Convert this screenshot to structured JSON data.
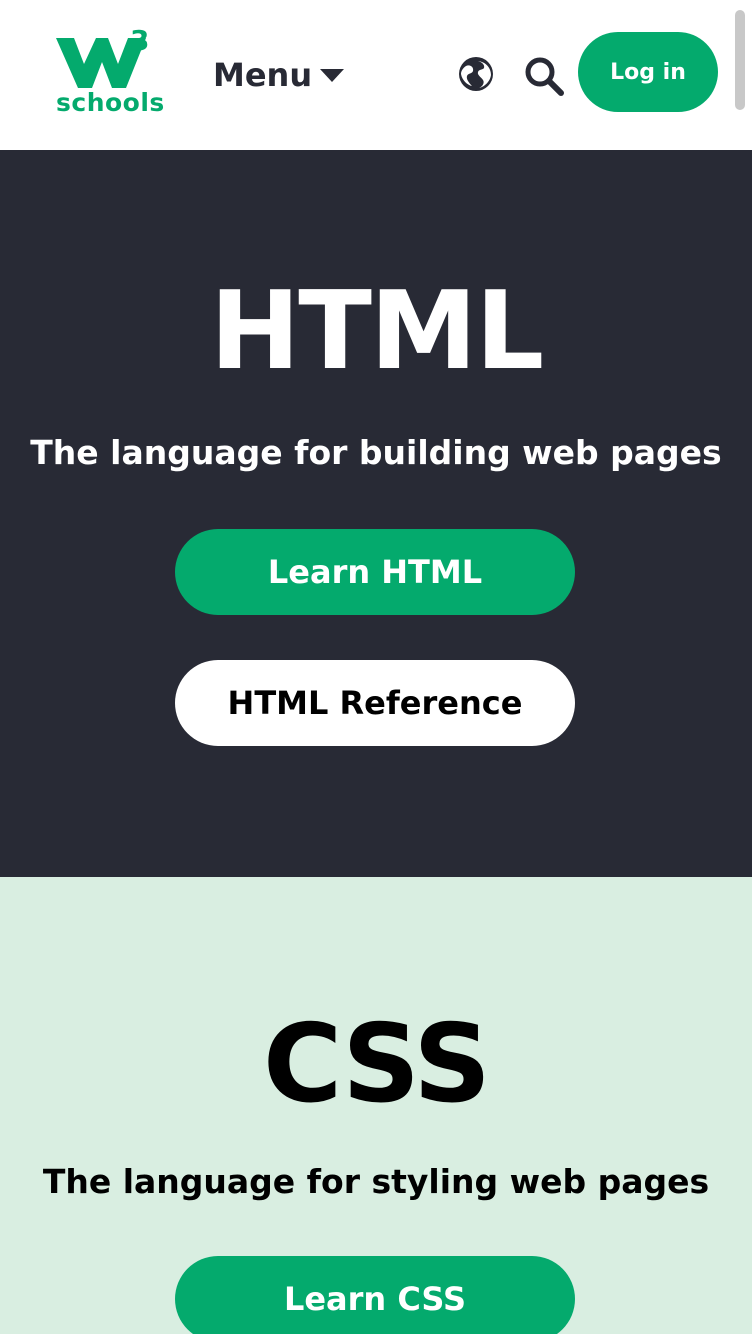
{
  "header": {
    "logo_text": "schools",
    "logo_superscript": "3",
    "menu_label": "Menu",
    "login_label": "Log in",
    "icons": [
      "globe-icon",
      "search-icon",
      "chevron-down-icon"
    ]
  },
  "sections": [
    {
      "title": "HTML",
      "subtitle": "The language for building web pages",
      "primary_button": "Learn HTML",
      "secondary_button": "HTML Reference"
    },
    {
      "title": "CSS",
      "subtitle": "The language for styling web pages",
      "primary_button": "Learn CSS"
    }
  ],
  "colors": {
    "brand_green": "#04aa6d",
    "dark_section": "#282a35",
    "light_section": "#d9eee1",
    "text_dark": "#282a35"
  }
}
